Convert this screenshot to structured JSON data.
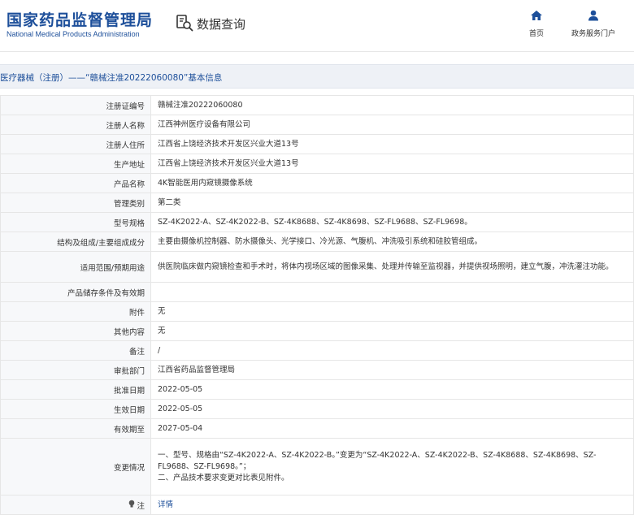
{
  "header": {
    "logo_cn": "国家药品监督管理局",
    "logo_en": "National Medical Products Administration",
    "query_label": "数据查询",
    "nav": [
      {
        "label": "首页",
        "icon": "home-icon"
      },
      {
        "label": "政务服务门户",
        "icon": "user-icon"
      }
    ]
  },
  "title": "医疗器械（注册）——“赣械注准20222060080”基本信息",
  "rows": [
    {
      "key": "注册证编号",
      "value": "赣械注准20222060080"
    },
    {
      "key": "注册人名称",
      "value": "江西神州医疗设备有限公司"
    },
    {
      "key": "注册人住所",
      "value": "江西省上饶经济技术开发区兴业大道13号"
    },
    {
      "key": "生产地址",
      "value": "江西省上饶经济技术开发区兴业大道13号"
    },
    {
      "key": "产品名称",
      "value": "4K智能医用内窥镜摄像系统"
    },
    {
      "key": "管理类别",
      "value": "第二类"
    },
    {
      "key": "型号规格",
      "value": "SZ-4K2022-A、SZ-4K2022-B、SZ-4K8688、SZ-4K8698、SZ-FL9688、SZ-FL9698。"
    },
    {
      "key": "结构及组成/主要组成成分",
      "value": "主要由摄像机控制器、防水摄像头、光学接口、冷光源、气腹机、冲洗吸引系统和硅胶管组成。"
    },
    {
      "key": "适用范围/预期用途",
      "value": "供医院临床做内窥镜检查和手术时，将体内视场区域的图像采集、处理并传输至监视器，并提供视场照明，建立气腹，冲洗灌注功能。"
    },
    {
      "key": "产品储存条件及有效期",
      "value": ""
    },
    {
      "key": "附件",
      "value": "无"
    },
    {
      "key": "其他内容",
      "value": "无"
    },
    {
      "key": "备注",
      "value": "/"
    },
    {
      "key": "审批部门",
      "value": "江西省药品监督管理局"
    },
    {
      "key": "批准日期",
      "value": "2022-05-05"
    },
    {
      "key": "生效日期",
      "value": "2022-05-05"
    },
    {
      "key": "有效期至",
      "value": "2027-05-04"
    },
    {
      "key": "变更情况",
      "value_line1": "一、型号、规格由“SZ-4K2022-A、SZ-4K2022-B。”变更为“SZ-4K2022-A、SZ-4K2022-B、SZ-4K8688、SZ-4K8698、SZ-FL9688、SZ-FL9698。”；",
      "value_line2": "二、产品技术要求变更对比表见附件。"
    },
    {
      "key": "注",
      "value": "详情"
    }
  ]
}
